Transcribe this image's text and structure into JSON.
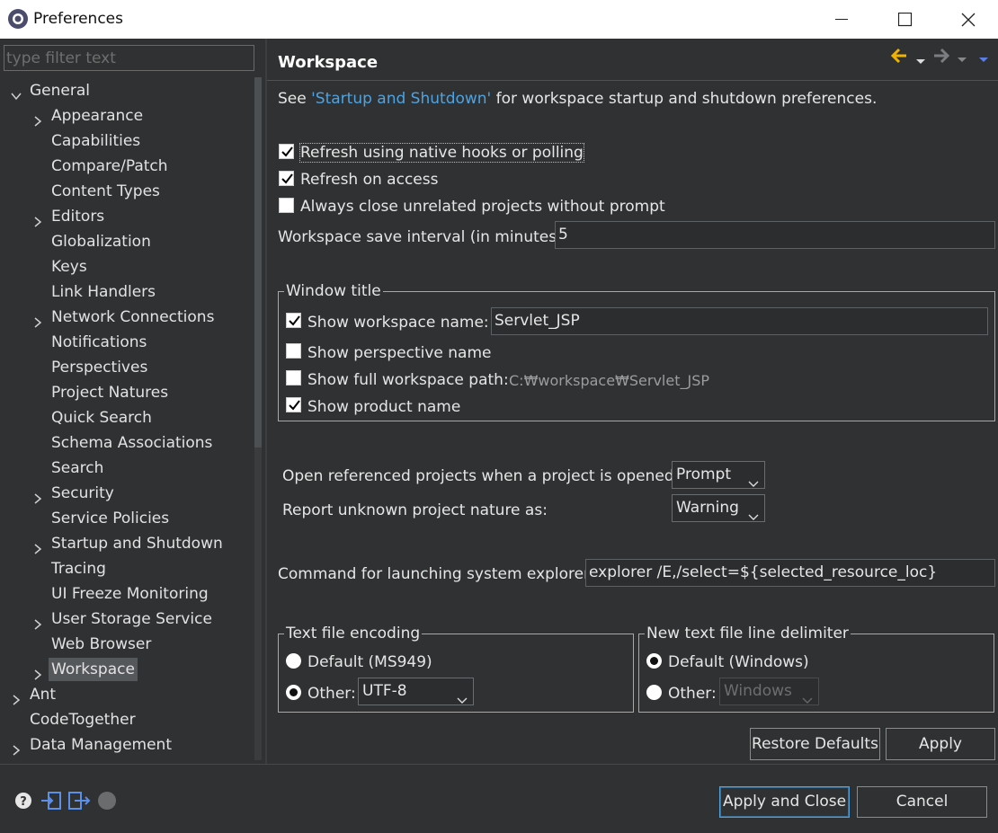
{
  "window": {
    "title": "Preferences",
    "minimize_icon": "minimize-icon",
    "maximize_icon": "maximize-icon",
    "close_icon": "close-icon"
  },
  "filter": {
    "placeholder": "type filter text",
    "value": ""
  },
  "tree": {
    "items": [
      {
        "label": "General",
        "expanded": true,
        "level": 0
      },
      {
        "label": "Appearance",
        "has_children": true,
        "level": 1
      },
      {
        "label": "Capabilities",
        "level": 1
      },
      {
        "label": "Compare/Patch",
        "level": 1
      },
      {
        "label": "Content Types",
        "level": 1
      },
      {
        "label": "Editors",
        "has_children": true,
        "level": 1
      },
      {
        "label": "Globalization",
        "level": 1
      },
      {
        "label": "Keys",
        "level": 1
      },
      {
        "label": "Link Handlers",
        "level": 1
      },
      {
        "label": "Network Connections",
        "has_children": true,
        "level": 1
      },
      {
        "label": "Notifications",
        "level": 1
      },
      {
        "label": "Perspectives",
        "level": 1
      },
      {
        "label": "Project Natures",
        "level": 1
      },
      {
        "label": "Quick Search",
        "level": 1
      },
      {
        "label": "Schema Associations",
        "level": 1
      },
      {
        "label": "Search",
        "level": 1
      },
      {
        "label": "Security",
        "has_children": true,
        "level": 1
      },
      {
        "label": "Service Policies",
        "level": 1
      },
      {
        "label": "Startup and Shutdown",
        "has_children": true,
        "level": 1
      },
      {
        "label": "Tracing",
        "level": 1
      },
      {
        "label": "UI Freeze Monitoring",
        "level": 1
      },
      {
        "label": "User Storage Service",
        "has_children": true,
        "level": 1
      },
      {
        "label": "Web Browser",
        "level": 1
      },
      {
        "label": "Workspace",
        "has_children": true,
        "level": 1,
        "selected": true
      },
      {
        "label": "Ant",
        "has_children": true,
        "level": 0
      },
      {
        "label": "CodeTogether",
        "level": 0
      },
      {
        "label": "Data Management",
        "has_children": true,
        "level": 0
      }
    ]
  },
  "page": {
    "title": "Workspace",
    "intro_prefix": "See ",
    "intro_link": "'Startup and Shutdown'",
    "intro_suffix": " for workspace startup and shutdown preferences.",
    "refresh_native": {
      "label": "Refresh using native hooks or polling",
      "checked": true
    },
    "refresh_access": {
      "label": "Refresh on access",
      "checked": true
    },
    "always_close": {
      "label": "Always close unrelated projects without prompt",
      "checked": false
    },
    "save_interval_label": "Workspace save interval (in minutes):",
    "save_interval_value": "5",
    "window_title_group": {
      "legend": "Window title",
      "show_workspace_name": {
        "label": "Show workspace name:",
        "checked": true,
        "value": "Servlet_JSP"
      },
      "show_perspective_name": {
        "label": "Show perspective name",
        "checked": false
      },
      "show_full_path": {
        "label": "Show full workspace path:",
        "checked": false,
        "value": "C:₩workspace₩Servlet_JSP"
      },
      "show_product_name": {
        "label": "Show product name",
        "checked": true
      }
    },
    "open_referenced_label": "Open referenced projects when a project is opened:",
    "open_referenced_value": "Prompt",
    "report_unknown_label": "Report unknown project nature as:",
    "report_unknown_value": "Warning",
    "explorer_label": "Command for launching system explorer:",
    "explorer_value": "explorer /E,/select=${selected_resource_loc}",
    "encoding_group": {
      "legend": "Text file encoding",
      "default_label": "Default (MS949)",
      "other_label": "Other:",
      "other_value": "UTF-8",
      "selected": "other"
    },
    "delimiter_group": {
      "legend": "New text file line delimiter",
      "default_label": "Default (Windows)",
      "other_label": "Other:",
      "other_value": "Windows",
      "selected": "default"
    },
    "restore_defaults": "Restore Defaults",
    "apply": "Apply"
  },
  "footer": {
    "apply_close": "Apply and Close",
    "cancel": "Cancel",
    "icons": [
      "help-icon",
      "import-icon",
      "export-icon",
      "record-icon"
    ]
  },
  "colors": {
    "background": "#2f3133",
    "link": "#4fa3e0",
    "accent_arrow": "#f0b400",
    "nav_down": "#5b7fe6"
  }
}
